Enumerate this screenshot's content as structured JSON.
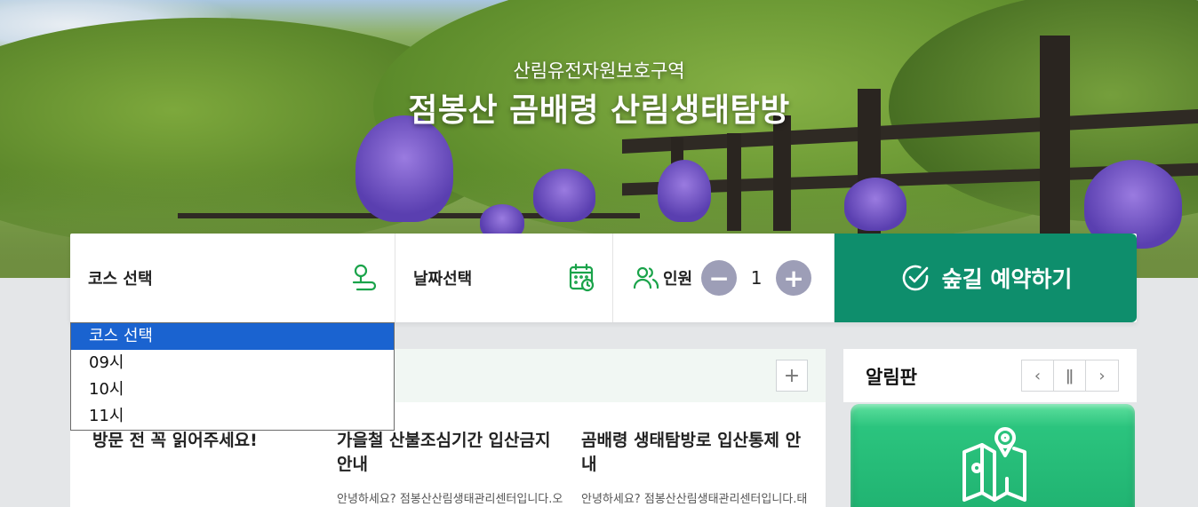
{
  "hero": {
    "subtitle": "산림유전자원보호구역",
    "title": "점봉산 곰배령 산림생태탐방"
  },
  "booking": {
    "course_label": "코스 선택",
    "course_icon": "trail-icon",
    "date_label": "날짜선택",
    "date_icon": "calendar-icon",
    "people_label": "인원",
    "people_icon": "people-icon",
    "minus": "−",
    "count": "1",
    "plus": "+",
    "reserve_label": "숲길 예약하기",
    "reserve_icon": "check-circle-icon",
    "accent_color": "#0e8e6c"
  },
  "course_dropdown": {
    "options": [
      "코스 선택",
      "09시",
      "10시",
      "11시"
    ],
    "selected": "코스 선택"
  },
  "notices": {
    "plus": "+",
    "items": [
      {
        "title": "방문 전 꼭 읽어주세요!",
        "desc": ""
      },
      {
        "title": "가을철 산불조심기간 입산금지 안내",
        "desc": "안녕하세요? 점봉산산림생태관리센터입니다.오"
      },
      {
        "title": "곰배령 생태탐방로 입산통제 안내",
        "desc": "안녕하세요? 점봉산산림생태관리센터입니다.태"
      }
    ]
  },
  "board": {
    "title": "알림판",
    "prev": "‹",
    "pause": "ǁ",
    "next": "›",
    "card_icon": "map-pin-icon"
  }
}
